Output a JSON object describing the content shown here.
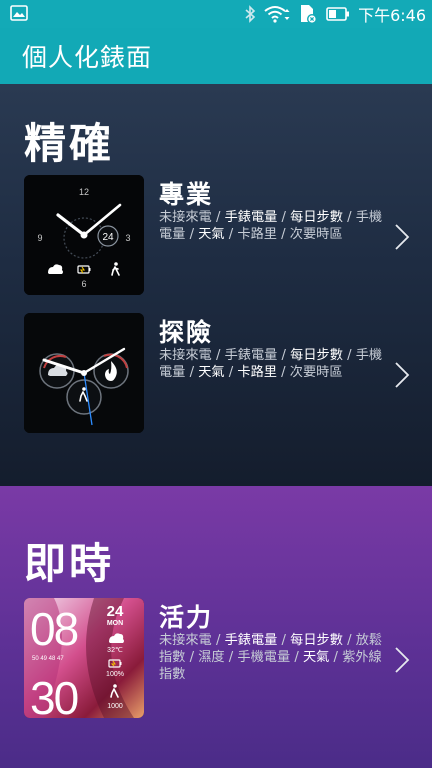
{
  "status_bar": {
    "time": "下午6:46",
    "icons": [
      "image-icon",
      "bluetooth-icon",
      "wifi-icon",
      "sim-off-icon",
      "battery-icon"
    ]
  },
  "app_bar": {
    "title": "個人化錶面"
  },
  "sections": [
    {
      "title": "精確",
      "faces": [
        {
          "name": "專業",
          "features": [
            "未接來電",
            "手錶電量",
            "每日步數",
            "手機電量",
            "天氣",
            "卡路里",
            "次要時區"
          ],
          "highlighted": [
            "手錶電量",
            "每日步數",
            "天氣"
          ],
          "thumb": {
            "top": "12",
            "left": "9",
            "right": "3",
            "bottom": "6",
            "sub_dial": "24"
          }
        },
        {
          "name": "探險",
          "features": [
            "未接來電",
            "手錶電量",
            "每日步數",
            "手機電量",
            "天氣",
            "卡路里",
            "次要時區"
          ],
          "highlighted": [
            "每日步數",
            "天氣",
            "卡路里"
          ],
          "thumb": {
            "top": "24"
          }
        }
      ]
    },
    {
      "title": "即時",
      "faces": [
        {
          "name": "活力",
          "features": [
            "未接來電",
            "手錶電量",
            "每日步數",
            "放鬆指數",
            "濕度",
            "手機電量",
            "天氣",
            "紫外線指數"
          ],
          "highlighted": [
            "手錶電量",
            "每日步數",
            "天氣"
          ],
          "thumb": {
            "hour": "08",
            "minute": "30",
            "seconds": "50 49 48 47",
            "day": "24",
            "weekday": "MON",
            "temp": "32℃",
            "battery": "100%",
            "steps": "1000"
          }
        }
      ]
    }
  ],
  "colors": {
    "status_bar": "#13aab7",
    "app_bar": "#12a9b6",
    "precise_bg": "#1e2c42",
    "live_bg": "#5e3196"
  }
}
